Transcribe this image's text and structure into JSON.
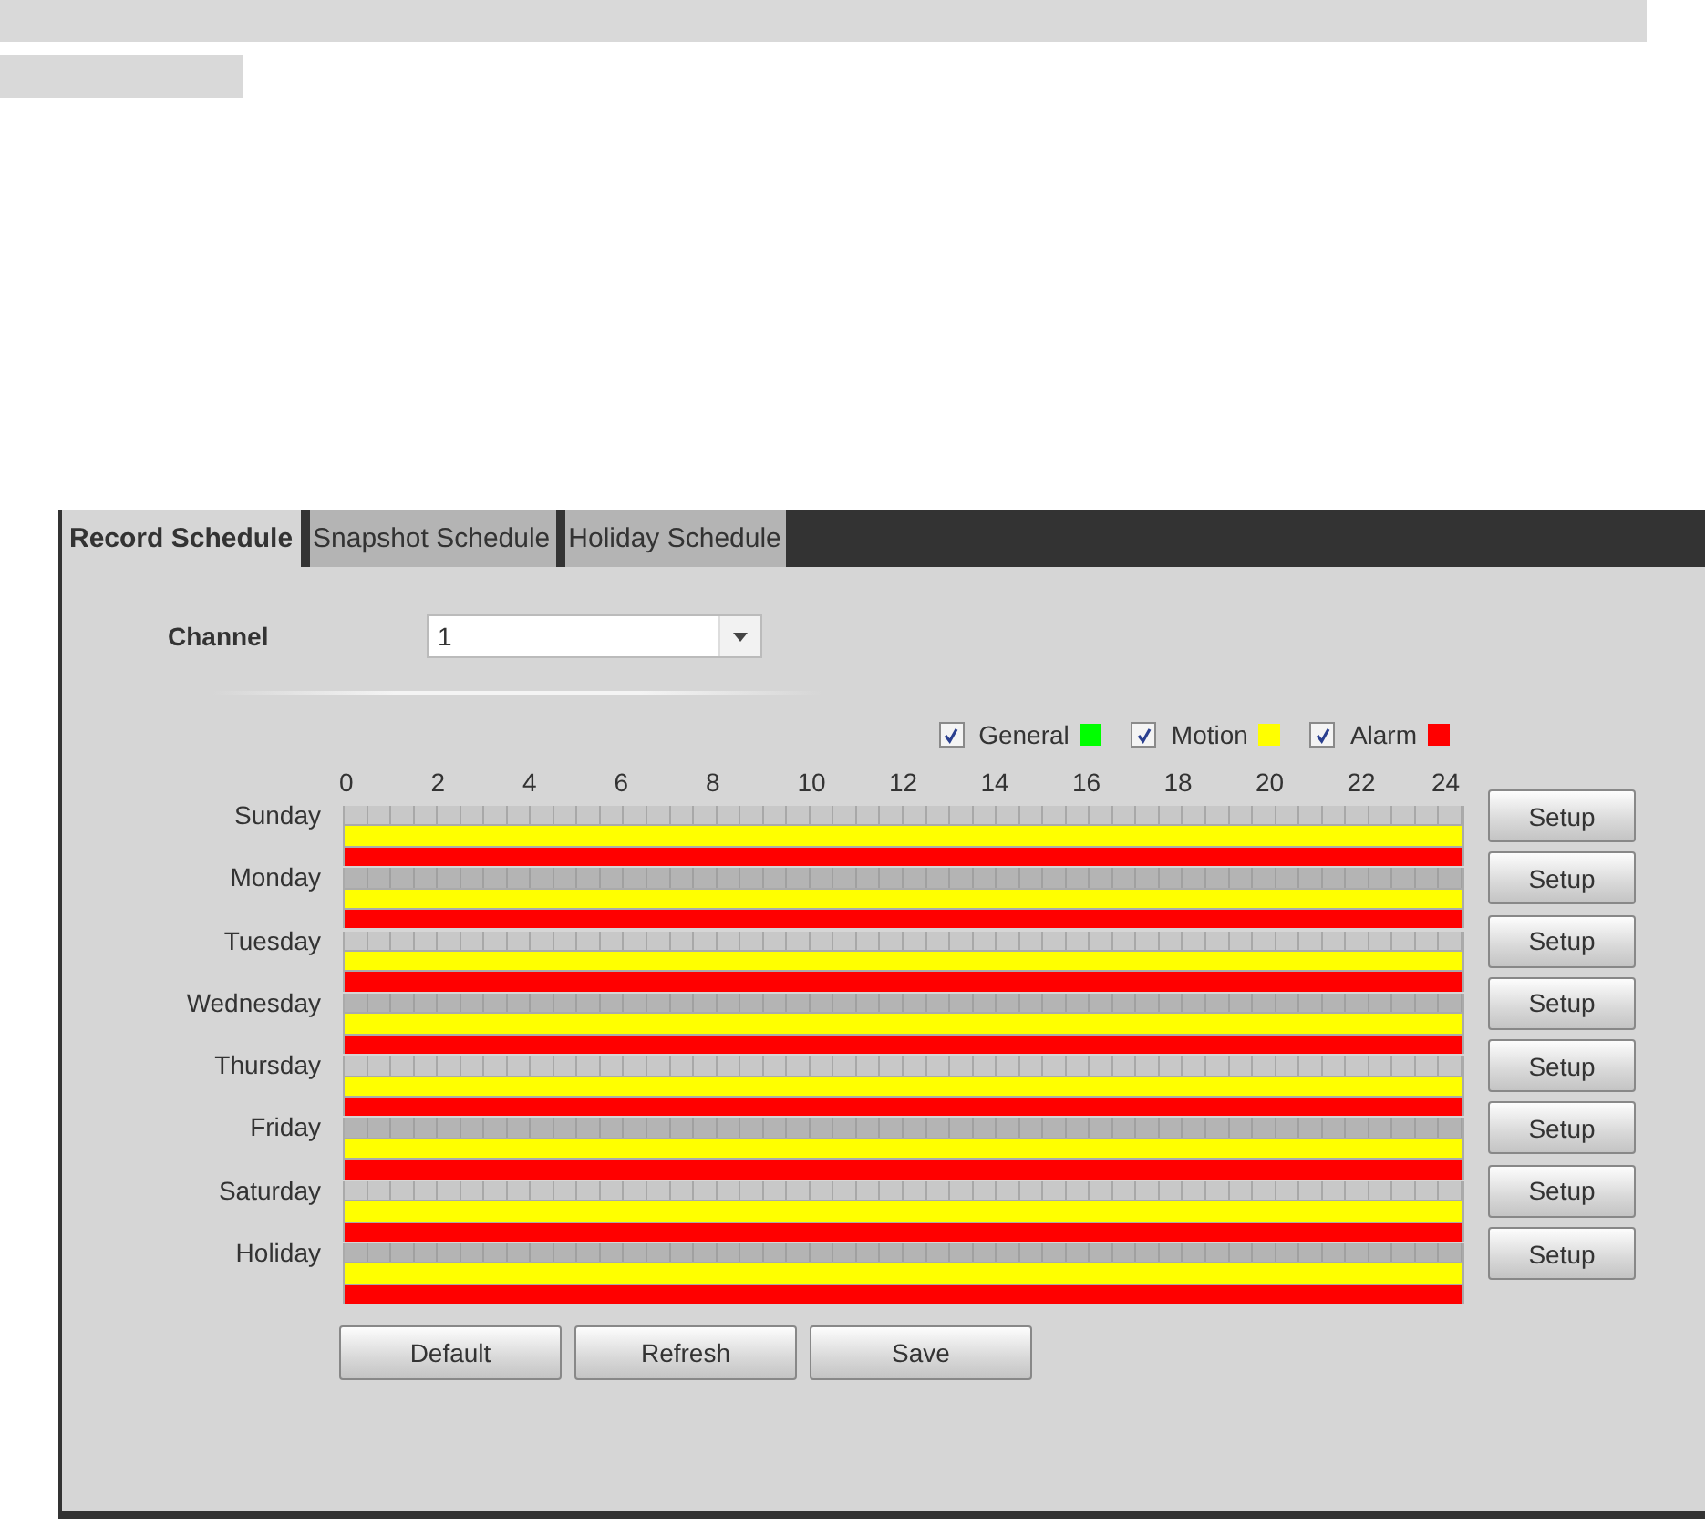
{
  "tabs": [
    {
      "label": "Record Schedule",
      "selected": true
    },
    {
      "label": "Snapshot Schedule",
      "selected": false
    },
    {
      "label": "Holiday Schedule",
      "selected": false
    }
  ],
  "channel": {
    "label": "Channel",
    "value": "1"
  },
  "legend": [
    {
      "kind": "general",
      "label": "General",
      "checked": true,
      "color": "#00ff00"
    },
    {
      "kind": "motion",
      "label": "Motion",
      "checked": true,
      "color": "#ffff00"
    },
    {
      "kind": "alarm",
      "label": "Alarm",
      "checked": true,
      "color": "#ff0000"
    }
  ],
  "hours": [
    "0",
    "2",
    "4",
    "6",
    "8",
    "10",
    "12",
    "14",
    "16",
    "18",
    "20",
    "22",
    "24"
  ],
  "days": [
    {
      "label": "Sunday",
      "general": false,
      "motion": true,
      "alarm": true,
      "button": "Setup"
    },
    {
      "label": "Monday",
      "general": false,
      "motion": true,
      "alarm": true,
      "button": "Setup"
    },
    {
      "label": "Tuesday",
      "general": false,
      "motion": true,
      "alarm": true,
      "button": "Setup"
    },
    {
      "label": "Wednesday",
      "general": false,
      "motion": true,
      "alarm": true,
      "button": "Setup"
    },
    {
      "label": "Thursday",
      "general": false,
      "motion": true,
      "alarm": true,
      "button": "Setup"
    },
    {
      "label": "Friday",
      "general": false,
      "motion": true,
      "alarm": true,
      "button": "Setup"
    },
    {
      "label": "Saturday",
      "general": false,
      "motion": true,
      "alarm": true,
      "button": "Setup"
    },
    {
      "label": "Holiday",
      "general": false,
      "motion": true,
      "alarm": true,
      "button": "Setup"
    }
  ],
  "buttons": [
    "Default",
    "Refresh",
    "Save"
  ]
}
